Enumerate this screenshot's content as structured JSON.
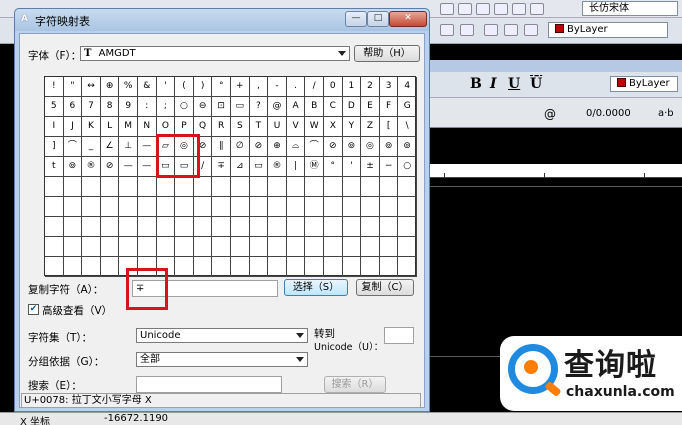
{
  "dialog": {
    "title": "字符映射表",
    "font_label": "字体（F）：",
    "font_value": "AMGDT",
    "font_icon_glyph": "T",
    "help_button": "帮助（H）",
    "copy_label": "复制字符（A）：",
    "copy_value": "∓",
    "select_button": "选择（S）",
    "copy_button": "复制（C）",
    "advanced_label": "高级查看（V）",
    "advanced_checked": true,
    "charset_label": "字符集（T）：",
    "charset_value": "Unicode",
    "goto_label_1": "转到",
    "goto_label_2": "Unicode（U）：",
    "goto_value": "",
    "group_label": "分组依据（G）：",
    "group_value": "全部",
    "search_label": "搜索（E）：",
    "search_value": "",
    "search_button": "搜索（R）",
    "status": "U+0078: 拉丁文小写字母 X",
    "grid_rows": [
      [
        "!",
        "\"",
        "↔",
        "⊕",
        "%",
        "&",
        "'",
        "(",
        ")",
        "°",
        "+",
        ",",
        "-",
        ".",
        "/",
        "0",
        "1",
        "2",
        "3",
        "4"
      ],
      [
        "5",
        "6",
        "7",
        "8",
        "9",
        ":",
        ";",
        "○",
        "⊖",
        "⊡",
        "▭",
        "?",
        "@",
        "A",
        "B",
        "C",
        "D",
        "E",
        "F",
        "G"
      ],
      [
        "I",
        "J",
        "K",
        "L",
        "M",
        "N",
        "O",
        "P",
        "Q",
        "R",
        "S",
        "T",
        "U",
        "V",
        "W",
        "X",
        "Y",
        "Z",
        "[",
        "\\"
      ],
      [
        "]",
        "⌒",
        "_",
        "∠",
        "⊥",
        "—",
        "▱",
        "◎",
        "⊘",
        "∥",
        "∅",
        "⊘",
        "⊕",
        "⌓",
        "⌒",
        "⊘",
        "⊚",
        "◎",
        "⊚",
        "⊚"
      ],
      [
        "t",
        "⊚",
        "®",
        "⊘",
        "—",
        "—",
        "▭",
        "▭",
        "∕",
        "∓",
        "⊿",
        "▭",
        "®",
        "|",
        "Ⓜ",
        "°",
        "'",
        "±",
        "−",
        "○"
      ],
      [
        "",
        "",
        "",
        "",
        "",
        "",
        "",
        "",
        "",
        "",
        "",
        "",
        "",
        "",
        "",
        "",
        "",
        "",
        "",
        ""
      ],
      [
        "",
        "",
        "",
        "",
        "",
        "",
        "",
        "",
        "",
        "",
        "",
        "",
        "",
        "",
        "",
        "",
        "",
        "",
        "",
        ""
      ],
      [
        "",
        "",
        "",
        "",
        "",
        "",
        "",
        "",
        "",
        "",
        "",
        "",
        "",
        "",
        "",
        "",
        "",
        "",
        "",
        ""
      ],
      [
        "",
        "",
        "",
        "",
        "",
        "",
        "",
        "",
        "",
        "",
        "",
        "",
        "",
        "",
        "",
        "",
        "",
        "",
        "",
        ""
      ],
      [
        "",
        "",
        "",
        "",
        "",
        "",
        "",
        "",
        "",
        "",
        "",
        "",
        "",
        "",
        "",
        "",
        "",
        "",
        "",
        ""
      ]
    ],
    "highlight_color": "#d9121b"
  },
  "background_app": {
    "font_box": "长仿宋体",
    "layer_box_1": "ByLayer",
    "layer_box_2": "ByLayer",
    "format_letters": [
      "B",
      "I",
      "U",
      "Ū"
    ],
    "format_value": "0/0.0000",
    "format_ab": "a·b",
    "at_symbol": "@",
    "coord_label": "X 坐标",
    "coord_value": "-16672.1190",
    "layer_color": "#c00000"
  },
  "watermark": {
    "text_cn": "查询啦",
    "text_en": "chaxunla.com",
    "accent_blue": "#1f8be0",
    "accent_orange": "#ff7d00"
  }
}
